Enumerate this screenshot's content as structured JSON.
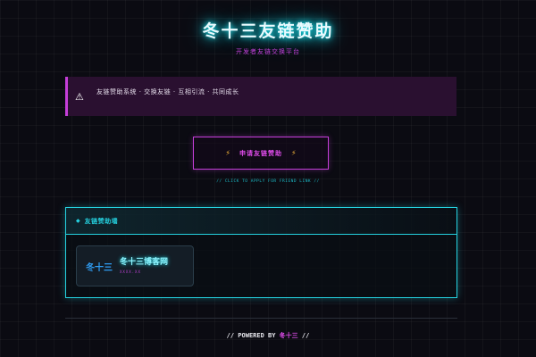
{
  "header": {
    "title": "冬十三友链赞助",
    "subtitle": "开发者友链交换平台"
  },
  "notice": {
    "icon": "warning-icon",
    "text": "友链赞助系统 · 交换友链 · 互相引流 · 共同成长"
  },
  "apply": {
    "label": "申请友链赞助",
    "icon": "bolt-icon",
    "hint": "// CLICK TO APPLY FOR FRIEND LINK //"
  },
  "panel": {
    "icon": "diamond-icon",
    "title": "友链赞助墙",
    "friends": [
      {
        "logo_text": "冬十三",
        "name": "冬十三博客网",
        "tag": "XXXX.XX"
      }
    ]
  },
  "footer": {
    "prefix": "// POWERED BY",
    "name": "冬十三",
    "suffix": "//"
  },
  "colors": {
    "background": "#0b0b12",
    "cyan_accent": "#25d2e0",
    "magenta_accent": "#c43ed8",
    "bolt": "#f5b63a"
  }
}
